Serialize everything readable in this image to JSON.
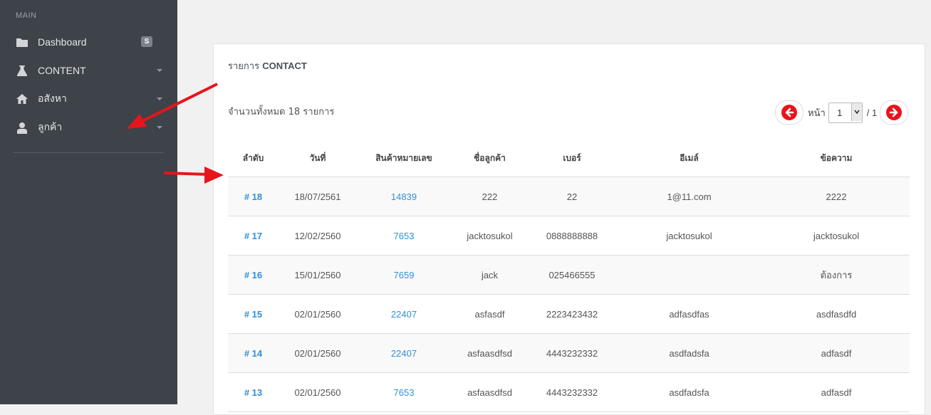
{
  "sidebar": {
    "section_title": "MAIN",
    "items": [
      {
        "label": "Dashboard",
        "icon": "folder-icon",
        "badge": "S"
      },
      {
        "label": "CONTENT",
        "icon": "flask-icon"
      },
      {
        "label": "อสังหา",
        "icon": "home-icon"
      },
      {
        "label": "ลูกค้า",
        "icon": "user-icon"
      }
    ]
  },
  "panel": {
    "title_prefix": "รายการ",
    "title_strong": "CONTACT",
    "total_text": "จำนวนทั้งหมด 18 รายการ",
    "pager": {
      "page_label": "หน้า",
      "current_page": "1",
      "of_text": "/ 1"
    }
  },
  "table": {
    "headers": [
      "ลำดับ",
      "วันที่",
      "สินค้าหมายเลข",
      "ชื่อลูกค้า",
      "เบอร์",
      "อีเมล์",
      "ข้อความ"
    ],
    "rows": [
      [
        "# 18",
        "18/07/2561",
        "14839",
        "222",
        "22",
        "1@11.com",
        "2222"
      ],
      [
        "# 17",
        "12/02/2560",
        "7653",
        "jacktosukol",
        "0888888888",
        "jacktosukol",
        "jacktosukol"
      ],
      [
        "# 16",
        "15/01/2560",
        "7659",
        "jack",
        "025466555",
        "",
        "ต้องการ"
      ],
      [
        "# 15",
        "02/01/2560",
        "22407",
        "asfasdf",
        "2223423432",
        "adfasdfas",
        "asdfasdfd"
      ],
      [
        "# 14",
        "02/01/2560",
        "22407",
        "asfaasdfsd",
        "4443232332",
        "asdfadsfa",
        "adfasdf"
      ],
      [
        "# 13",
        "02/01/2560",
        "7653",
        "asfaasdfsd",
        "4443232332",
        "asdfadsfa",
        "adfasdf"
      ]
    ]
  },
  "colors": {
    "sidebar_bg": "#3d4349",
    "link": "#2f8fd8",
    "pager_button": "#e8141c",
    "annotation_arrow": "#e8141c"
  }
}
